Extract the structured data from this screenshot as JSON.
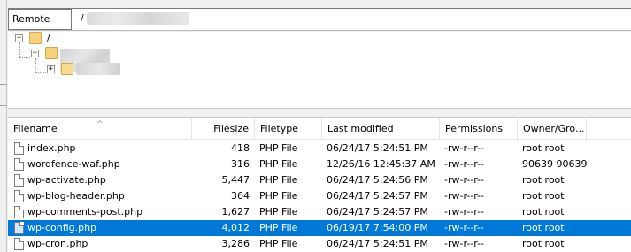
{
  "remote_site": {
    "label": "Remote site:",
    "path_prefix": "/"
  },
  "tree": {
    "root_label": "/"
  },
  "file_list": {
    "columns": [
      "Filename",
      "Filesize",
      "Filetype",
      "Last modified",
      "Permissions",
      "Owner/Gro..."
    ],
    "sort_column": "Filename",
    "selected_index": 5,
    "rows": [
      {
        "name": "index.php",
        "size": "418",
        "type": "PHP File",
        "modified": "06/24/17 5:24:51 PM",
        "perms": "-rw-r--r--",
        "owner": "root root"
      },
      {
        "name": "wordfence-waf.php",
        "size": "316",
        "type": "PHP File",
        "modified": "12/26/16 12:45:37 AM",
        "perms": "-rw-r--r--",
        "owner": "90639 90639"
      },
      {
        "name": "wp-activate.php",
        "size": "5,447",
        "type": "PHP File",
        "modified": "06/24/17 5:24:56 PM",
        "perms": "-rw-r--r--",
        "owner": "root root"
      },
      {
        "name": "wp-blog-header.php",
        "size": "364",
        "type": "PHP File",
        "modified": "06/24/17 5:24:57 PM",
        "perms": "-rw-r--r--",
        "owner": "root root"
      },
      {
        "name": "wp-comments-post.php",
        "size": "1,627",
        "type": "PHP File",
        "modified": "06/24/17 5:24:57 PM",
        "perms": "-rw-r--r--",
        "owner": "root root"
      },
      {
        "name": "wp-config.php",
        "size": "4,012",
        "type": "PHP File",
        "modified": "06/19/17 7:54:00 PM",
        "perms": "-rw-r--r--",
        "owner": "root root"
      },
      {
        "name": "wp-cron.php",
        "size": "3,286",
        "type": "PHP File",
        "modified": "06/24/17 5:24:51 PM",
        "perms": "-rw-r--r--",
        "owner": "root root"
      }
    ]
  },
  "icons": {
    "file": "php-file-icon",
    "folder": "folder-icon",
    "sort": "sort-ascending-icon"
  },
  "colors": {
    "selection": "#0078d7",
    "folder": "#f6d27a"
  }
}
